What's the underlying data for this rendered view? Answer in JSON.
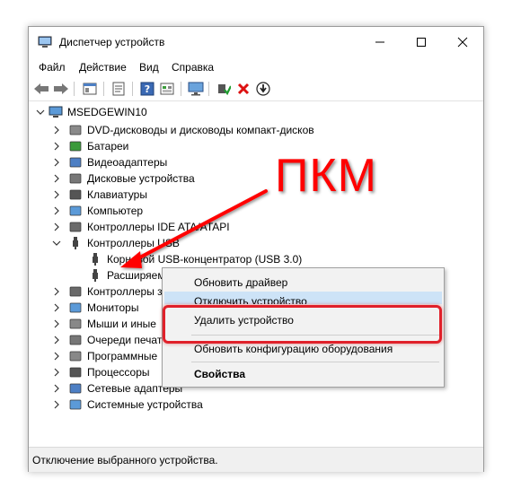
{
  "window": {
    "title": "Диспетчер устройств"
  },
  "menu": [
    "Файл",
    "Действие",
    "Вид",
    "Справка"
  ],
  "toolbar": {
    "icons": [
      "back-arrow-icon",
      "forward-arrow-icon",
      "show-hide-tree-icon",
      "properties-icon",
      "help-icon",
      "view-icon",
      "monitor-icon",
      "enable-device-icon",
      "remove-x-icon",
      "download-driver-icon"
    ]
  },
  "tree": {
    "root": "MSEDGEWIN10",
    "items": [
      "DVD-дисководы и дисководы компакт-дисков",
      "Батареи",
      "Видеоадаптеры",
      "Дисковые устройства",
      "Клавиатуры",
      "Компьютер",
      "Контроллеры IDE ATA/ATAPI",
      "Контроллеры USB",
      "Корневой USB-концентратор (USB 3.0)",
      "Расширяемый",
      "Контроллеры з",
      "Мониторы",
      "Мыши и иные",
      "Очереди печат",
      "Программные",
      "Процессоры",
      "Сетевые адаптеры",
      "Системные устройства"
    ]
  },
  "context_menu": {
    "items": [
      "Обновить драйвер",
      "Отключить устройство",
      "Удалить устройство",
      "Обновить конфигурацию оборудования",
      "Свойства"
    ]
  },
  "annotation": {
    "label": "ПКМ",
    "color": "#ff0000"
  },
  "status": {
    "text": "Отключение выбранного устройства."
  }
}
